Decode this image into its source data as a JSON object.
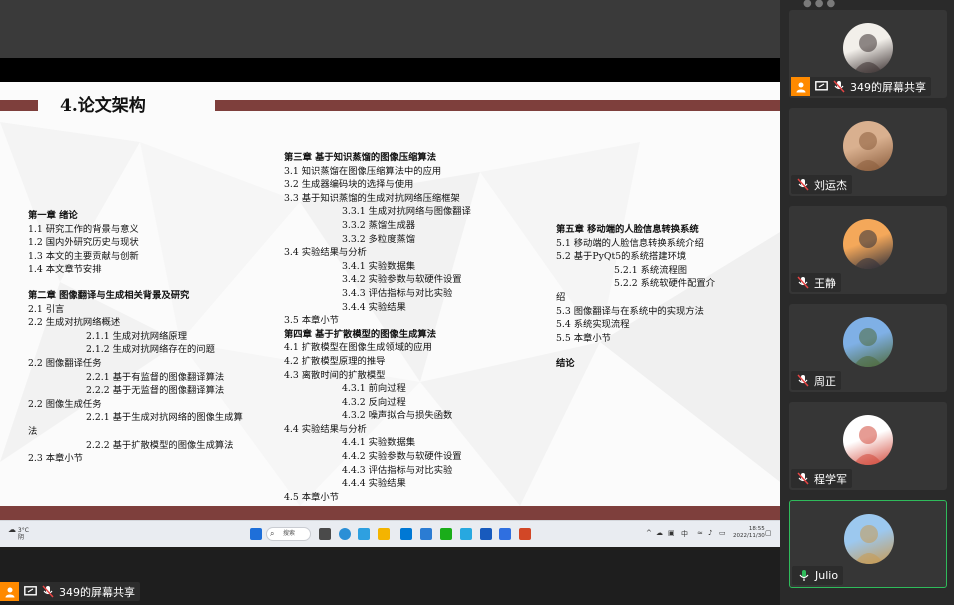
{
  "slide": {
    "title": "4.论文架构",
    "col1": [
      {
        "text": "第一章 绪论",
        "type": "h"
      },
      {
        "text": "1.1 研究工作的背景与意义",
        "type": "n"
      },
      {
        "text": "1.2 国内外研究历史与现状",
        "type": "n"
      },
      {
        "text": "1.3 本文的主要贡献与创新",
        "type": "n"
      },
      {
        "text": "1.4 本文章节安排",
        "type": "n"
      },
      {
        "text": "",
        "type": "gap"
      },
      {
        "text": "第二章 图像翻译与生成相关背景及研究",
        "type": "h"
      },
      {
        "text": "2.1 引言",
        "type": "n"
      },
      {
        "text": "2.2 生成对抗网络概述",
        "type": "n"
      },
      {
        "text": "2.1.1 生成对抗网络原理",
        "type": "i"
      },
      {
        "text": "2.1.2 生成对抗网络存在的问题",
        "type": "i"
      },
      {
        "text": "2.2 图像翻译任务",
        "type": "n"
      },
      {
        "text": "2.2.1 基于有监督的图像翻译算法",
        "type": "i"
      },
      {
        "text": "2.2.2 基于无监督的图像翻译算法",
        "type": "i"
      },
      {
        "text": "2.2 图像生成任务",
        "type": "n"
      },
      {
        "text": "2.2.1 基于生成对抗网络的图像生成算",
        "type": "i"
      },
      {
        "text": "法",
        "type": "n"
      },
      {
        "text": "2.2.2 基于扩散模型的图像生成算法",
        "type": "i"
      },
      {
        "text": "2.3 本章小节",
        "type": "n"
      }
    ],
    "col2": [
      {
        "text": "第三章 基于知识蒸馏的图像压缩算法",
        "type": "h"
      },
      {
        "text": "3.1 知识蒸馏在图像压缩算法中的应用",
        "type": "n"
      },
      {
        "text": "3.2 生成器编码块的选择与使用",
        "type": "n"
      },
      {
        "text": "3.3 基于知识蒸馏的生成对抗网络压缩框架",
        "type": "n"
      },
      {
        "text": "3.3.1 生成对抗网络与图像翻译",
        "type": "i"
      },
      {
        "text": "3.3.2 蒸馏生成器",
        "type": "i"
      },
      {
        "text": "3.3.2 多粒度蒸馏",
        "type": "i"
      },
      {
        "text": "3.4 实验结果与分析",
        "type": "n"
      },
      {
        "text": "3.4.1 实验数据集",
        "type": "i"
      },
      {
        "text": "3.4.2 实验参数与软硬件设置",
        "type": "i"
      },
      {
        "text": "3.4.3 评估指标与对比实验",
        "type": "i"
      },
      {
        "text": "3.4.4 实验结果",
        "type": "i"
      },
      {
        "text": "3.5 本章小节",
        "type": "n"
      },
      {
        "text": "第四章 基于扩散模型的图像生成算法",
        "type": "h"
      },
      {
        "text": "4.1 扩散模型在图像生成领域的应用",
        "type": "n"
      },
      {
        "text": "4.2 扩散模型原理的推导",
        "type": "n"
      },
      {
        "text": "4.3 离散时间的扩散模型",
        "type": "n"
      },
      {
        "text": "4.3.1 前向过程",
        "type": "i"
      },
      {
        "text": "4.3.2 反向过程",
        "type": "i"
      },
      {
        "text": "4.3.2 噪声拟合与损失函数",
        "type": "i"
      },
      {
        "text": "4.4 实验结果与分析",
        "type": "n"
      },
      {
        "text": "4.4.1 实验数据集",
        "type": "i"
      },
      {
        "text": "4.4.2 实验参数与软硬件设置",
        "type": "i"
      },
      {
        "text": "4.4.3 评估指标与对比实验",
        "type": "i"
      },
      {
        "text": "4.4.4 实验结果",
        "type": "i"
      },
      {
        "text": "4.5 本章小节",
        "type": "n"
      }
    ],
    "col3": [
      {
        "text": "第五章 移动端的人脸信息转换系统",
        "type": "h"
      },
      {
        "text": "5.1 移动端的人脸信息转换系统介绍",
        "type": "n"
      },
      {
        "text": "5.2 基于PyQt5的系统搭建环境",
        "type": "n"
      },
      {
        "text": "5.2.1 系统流程图",
        "type": "i"
      },
      {
        "text": "5.2.2 系统软硬件配置介",
        "type": "i"
      },
      {
        "text": "绍",
        "type": "n"
      },
      {
        "text": "5.3 图像翻译与在系统中的实现方法",
        "type": "n"
      },
      {
        "text": "5.4 系统实现流程",
        "type": "n"
      },
      {
        "text": "5.5 本章小节",
        "type": "n"
      },
      {
        "text": "",
        "type": "gap"
      },
      {
        "text": "结论",
        "type": "h"
      }
    ]
  },
  "taskbar": {
    "weather_temp": "3°C",
    "weather_desc": "阴",
    "search_label": "搜索",
    "tray_up": "^",
    "ime": "中",
    "clock_time": "18:55",
    "clock_date": "2022/11/30"
  },
  "sharer": {
    "label": "349的屏幕共享"
  },
  "participants": [
    {
      "name": "349的屏幕共享",
      "sharing": true,
      "active": false,
      "avatar_colors": [
        "#f2efea",
        "#3a3030"
      ]
    },
    {
      "name": "刘运杰",
      "sharing": false,
      "active": false,
      "avatar_colors": [
        "#d9b08f",
        "#8a5c3c"
      ]
    },
    {
      "name": "王静",
      "sharing": false,
      "active": false,
      "avatar_colors": [
        "#f4a85a",
        "#2b2d3a"
      ]
    },
    {
      "name": "周正",
      "sharing": false,
      "active": false,
      "avatar_colors": [
        "#7fb0e6",
        "#4f6a3a"
      ]
    },
    {
      "name": "程学军",
      "sharing": false,
      "active": false,
      "avatar_colors": [
        "#ffffff",
        "#d24a3c"
      ]
    },
    {
      "name": "Julio",
      "sharing": false,
      "active": true,
      "avatar_colors": [
        "#9cc8ef",
        "#c89a52"
      ]
    }
  ],
  "colors": {
    "accent_band": "#7e3f3c",
    "orange": "#ff8a00",
    "mic_on": "#2fbb5b",
    "mic_muted": "#e84545"
  }
}
